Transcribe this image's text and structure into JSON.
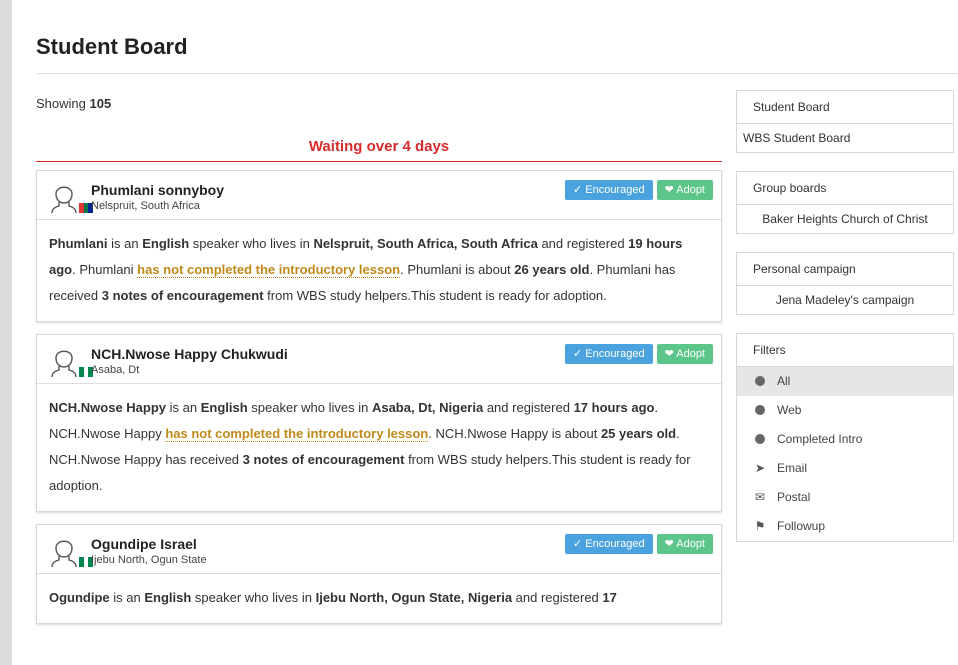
{
  "page": {
    "title": "Student Board"
  },
  "summary": {
    "showing_label": "Showing",
    "count": "105"
  },
  "section": {
    "waiting_label": "Waiting over 4 days"
  },
  "badges": {
    "encouraged": "✓  Encouraged",
    "adopt": "❤  Adopt"
  },
  "students": [
    {
      "name": "Phumlani sonnyboy",
      "location": "Nelspruit, South Africa",
      "body": {
        "first": "Phumlani",
        "t1": " is an ",
        "language": "English",
        "t2": " speaker who lives in ",
        "place": "Nelspruit, South Africa, South Africa",
        "t3": " and registered ",
        "registered": "19 hours ago",
        "t4": ". Phumlani ",
        "intro": "has not completed the introductory lesson",
        "t5": ". Phumlani is about ",
        "age": "26 years old",
        "t6": ". Phumlani has received ",
        "notes": "3 notes of encouragement",
        "t7": " from WBS study helpers.This student is ready for adoption."
      }
    },
    {
      "name": "NCH.Nwose Happy Chukwudi",
      "location": "Asaba, Dt",
      "body": {
        "first": "NCH.Nwose Happy",
        "t1": " is an ",
        "language": "English",
        "t2": " speaker who lives in ",
        "place": "Asaba, Dt, Nigeria",
        "t3": " and registered ",
        "registered": "17 hours ago",
        "t4": ". NCH.Nwose Happy ",
        "intro": "has not completed the introductory lesson",
        "t5": ". NCH.Nwose Happy is about ",
        "age": "25 years old",
        "t6": ". NCH.Nwose Happy has received ",
        "notes": "3 notes of encouragement",
        "t7": " from WBS study helpers.This student is ready for adoption."
      }
    },
    {
      "name": "Ogundipe Israel",
      "location": "Ijebu North, Ogun State",
      "body": {
        "first": "Ogundipe",
        "t1": " is an ",
        "language": "English",
        "t2": " speaker who lives in ",
        "place": "Ijebu North, Ogun State, Nigeria",
        "t3": " and registered ",
        "registered": "17"
      }
    }
  ],
  "sidebar": {
    "board": {
      "heading": "Student Board",
      "item": "WBS Student Board"
    },
    "groups": {
      "heading": "Group boards",
      "item": "Baker Heights Church of Christ"
    },
    "campaign": {
      "heading": "Personal campaign",
      "item": "Jena Madeley's campaign"
    },
    "filters": {
      "heading": "Filters",
      "items": [
        {
          "label": "All",
          "icon": "globe-icon",
          "active": true
        },
        {
          "label": "Web",
          "icon": "globe-icon"
        },
        {
          "label": "Completed Intro",
          "icon": "globe-icon"
        },
        {
          "label": "Email",
          "icon": "send-icon"
        },
        {
          "label": "Postal",
          "icon": "envelope-icon"
        },
        {
          "label": "Followup",
          "icon": "flag-icon"
        }
      ]
    }
  },
  "colors": {
    "accent_red": "#d62b2b",
    "encouraged": "#4aa3df",
    "adopt": "#5cc58a",
    "warning": "#c08a1b"
  }
}
